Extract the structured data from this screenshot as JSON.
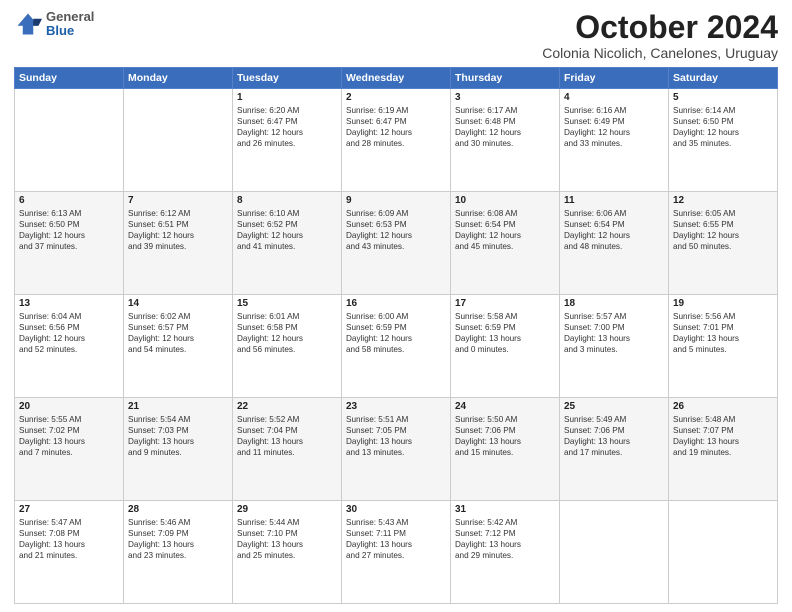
{
  "header": {
    "logo_general": "General",
    "logo_blue": "Blue",
    "month_title": "October 2024",
    "subtitle": "Colonia Nicolich, Canelones, Uruguay"
  },
  "weekdays": [
    "Sunday",
    "Monday",
    "Tuesday",
    "Wednesday",
    "Thursday",
    "Friday",
    "Saturday"
  ],
  "weeks": [
    [
      {
        "day": "",
        "detail": ""
      },
      {
        "day": "",
        "detail": ""
      },
      {
        "day": "1",
        "detail": "Sunrise: 6:20 AM\nSunset: 6:47 PM\nDaylight: 12 hours\nand 26 minutes."
      },
      {
        "day": "2",
        "detail": "Sunrise: 6:19 AM\nSunset: 6:47 PM\nDaylight: 12 hours\nand 28 minutes."
      },
      {
        "day": "3",
        "detail": "Sunrise: 6:17 AM\nSunset: 6:48 PM\nDaylight: 12 hours\nand 30 minutes."
      },
      {
        "day": "4",
        "detail": "Sunrise: 6:16 AM\nSunset: 6:49 PM\nDaylight: 12 hours\nand 33 minutes."
      },
      {
        "day": "5",
        "detail": "Sunrise: 6:14 AM\nSunset: 6:50 PM\nDaylight: 12 hours\nand 35 minutes."
      }
    ],
    [
      {
        "day": "6",
        "detail": "Sunrise: 6:13 AM\nSunset: 6:50 PM\nDaylight: 12 hours\nand 37 minutes."
      },
      {
        "day": "7",
        "detail": "Sunrise: 6:12 AM\nSunset: 6:51 PM\nDaylight: 12 hours\nand 39 minutes."
      },
      {
        "day": "8",
        "detail": "Sunrise: 6:10 AM\nSunset: 6:52 PM\nDaylight: 12 hours\nand 41 minutes."
      },
      {
        "day": "9",
        "detail": "Sunrise: 6:09 AM\nSunset: 6:53 PM\nDaylight: 12 hours\nand 43 minutes."
      },
      {
        "day": "10",
        "detail": "Sunrise: 6:08 AM\nSunset: 6:54 PM\nDaylight: 12 hours\nand 45 minutes."
      },
      {
        "day": "11",
        "detail": "Sunrise: 6:06 AM\nSunset: 6:54 PM\nDaylight: 12 hours\nand 48 minutes."
      },
      {
        "day": "12",
        "detail": "Sunrise: 6:05 AM\nSunset: 6:55 PM\nDaylight: 12 hours\nand 50 minutes."
      }
    ],
    [
      {
        "day": "13",
        "detail": "Sunrise: 6:04 AM\nSunset: 6:56 PM\nDaylight: 12 hours\nand 52 minutes."
      },
      {
        "day": "14",
        "detail": "Sunrise: 6:02 AM\nSunset: 6:57 PM\nDaylight: 12 hours\nand 54 minutes."
      },
      {
        "day": "15",
        "detail": "Sunrise: 6:01 AM\nSunset: 6:58 PM\nDaylight: 12 hours\nand 56 minutes."
      },
      {
        "day": "16",
        "detail": "Sunrise: 6:00 AM\nSunset: 6:59 PM\nDaylight: 12 hours\nand 58 minutes."
      },
      {
        "day": "17",
        "detail": "Sunrise: 5:58 AM\nSunset: 6:59 PM\nDaylight: 13 hours\nand 0 minutes."
      },
      {
        "day": "18",
        "detail": "Sunrise: 5:57 AM\nSunset: 7:00 PM\nDaylight: 13 hours\nand 3 minutes."
      },
      {
        "day": "19",
        "detail": "Sunrise: 5:56 AM\nSunset: 7:01 PM\nDaylight: 13 hours\nand 5 minutes."
      }
    ],
    [
      {
        "day": "20",
        "detail": "Sunrise: 5:55 AM\nSunset: 7:02 PM\nDaylight: 13 hours\nand 7 minutes."
      },
      {
        "day": "21",
        "detail": "Sunrise: 5:54 AM\nSunset: 7:03 PM\nDaylight: 13 hours\nand 9 minutes."
      },
      {
        "day": "22",
        "detail": "Sunrise: 5:52 AM\nSunset: 7:04 PM\nDaylight: 13 hours\nand 11 minutes."
      },
      {
        "day": "23",
        "detail": "Sunrise: 5:51 AM\nSunset: 7:05 PM\nDaylight: 13 hours\nand 13 minutes."
      },
      {
        "day": "24",
        "detail": "Sunrise: 5:50 AM\nSunset: 7:06 PM\nDaylight: 13 hours\nand 15 minutes."
      },
      {
        "day": "25",
        "detail": "Sunrise: 5:49 AM\nSunset: 7:06 PM\nDaylight: 13 hours\nand 17 minutes."
      },
      {
        "day": "26",
        "detail": "Sunrise: 5:48 AM\nSunset: 7:07 PM\nDaylight: 13 hours\nand 19 minutes."
      }
    ],
    [
      {
        "day": "27",
        "detail": "Sunrise: 5:47 AM\nSunset: 7:08 PM\nDaylight: 13 hours\nand 21 minutes."
      },
      {
        "day": "28",
        "detail": "Sunrise: 5:46 AM\nSunset: 7:09 PM\nDaylight: 13 hours\nand 23 minutes."
      },
      {
        "day": "29",
        "detail": "Sunrise: 5:44 AM\nSunset: 7:10 PM\nDaylight: 13 hours\nand 25 minutes."
      },
      {
        "day": "30",
        "detail": "Sunrise: 5:43 AM\nSunset: 7:11 PM\nDaylight: 13 hours\nand 27 minutes."
      },
      {
        "day": "31",
        "detail": "Sunrise: 5:42 AM\nSunset: 7:12 PM\nDaylight: 13 hours\nand 29 minutes."
      },
      {
        "day": "",
        "detail": ""
      },
      {
        "day": "",
        "detail": ""
      }
    ]
  ]
}
